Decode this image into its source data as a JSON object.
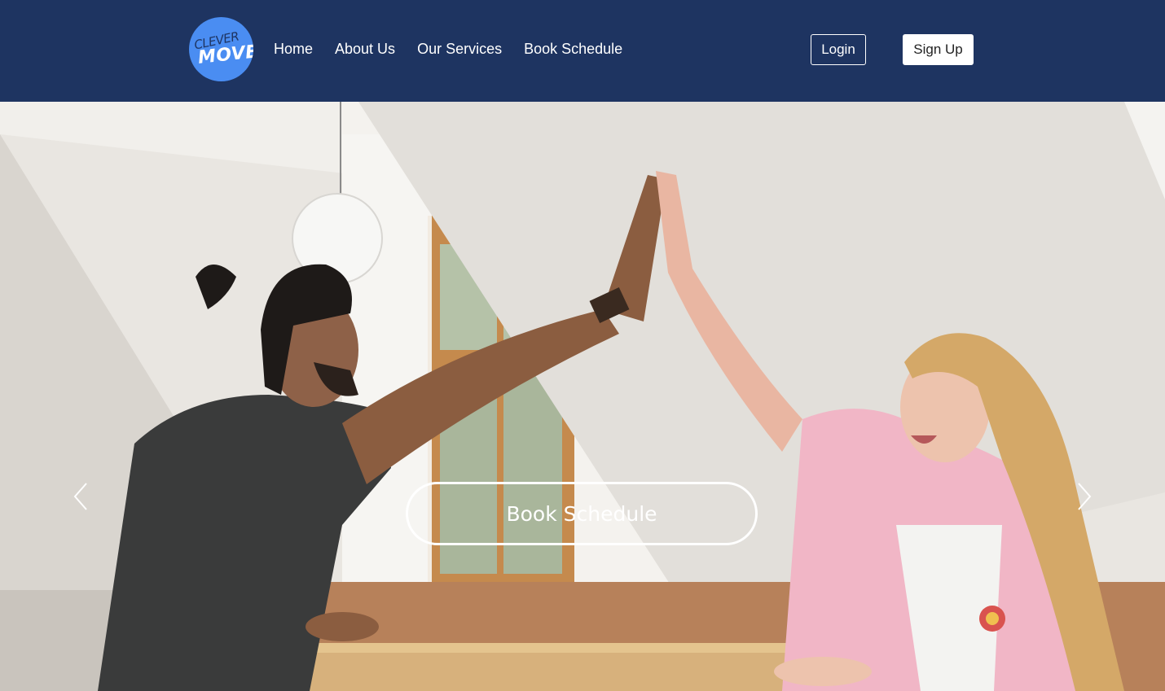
{
  "brand": {
    "logo_text_top": "CLEVER",
    "logo_text_bottom": "MOVE",
    "logo_color": "#4a8df2"
  },
  "nav": {
    "background": "#1e3461",
    "links": [
      "Home",
      "About Us",
      "Our Services",
      "Book Schedule"
    ],
    "login_label": "Login",
    "signup_label": "Sign Up"
  },
  "hero": {
    "cta_label": "Book Schedule",
    "prev_icon": "chevron-left-icon",
    "next_icon": "chevron-right-icon"
  }
}
